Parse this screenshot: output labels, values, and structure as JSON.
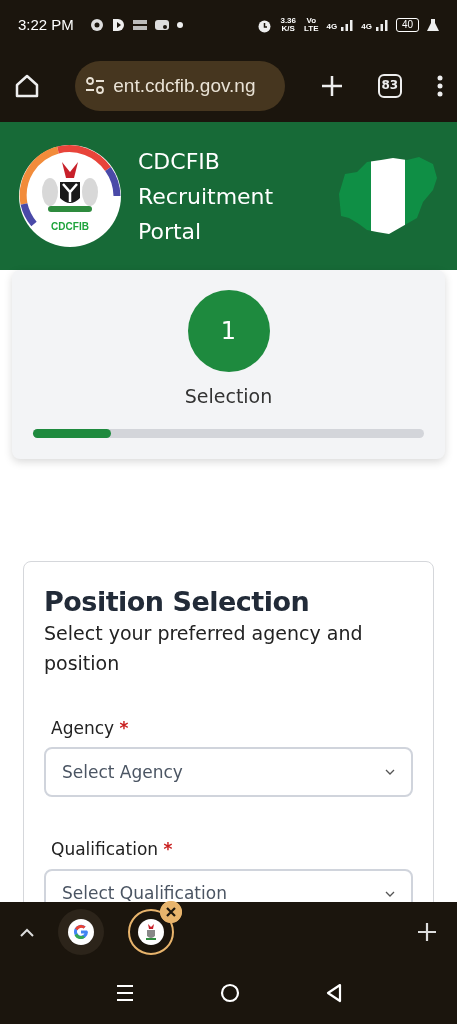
{
  "status_bar": {
    "time": "3:22 PM",
    "speed": "3.36",
    "speed_unit": "K/S",
    "volte_top": "Vo",
    "volte_bottom": "LTE",
    "network_1": "4G",
    "network_2": "4G",
    "battery": "40"
  },
  "browser": {
    "url": "ent.cdcfib.gov.ng",
    "tab_count": "83"
  },
  "header": {
    "logo_text": "CDCFIB",
    "title_lines": [
      "CDCFIB",
      "Recruitment",
      "Portal"
    ]
  },
  "stepper": {
    "steps": [
      {
        "number": "1",
        "label": "Selection",
        "selected": true
      }
    ],
    "level": 0.2
  },
  "form": {
    "title": "Position Selection",
    "subtitle": "Select your preferred agency and position",
    "fields": [
      {
        "label": "Agency",
        "required": true,
        "required_mark": "*",
        "placeholder": "Select Agency"
      },
      {
        "label": "Qualification",
        "required": true,
        "required_mark": "*",
        "placeholder": "Select Qualification"
      }
    ]
  },
  "tab_strip": {
    "tabs": [
      {
        "kind": "google",
        "selected": false
      },
      {
        "kind": "site",
        "selected": true
      }
    ]
  }
}
